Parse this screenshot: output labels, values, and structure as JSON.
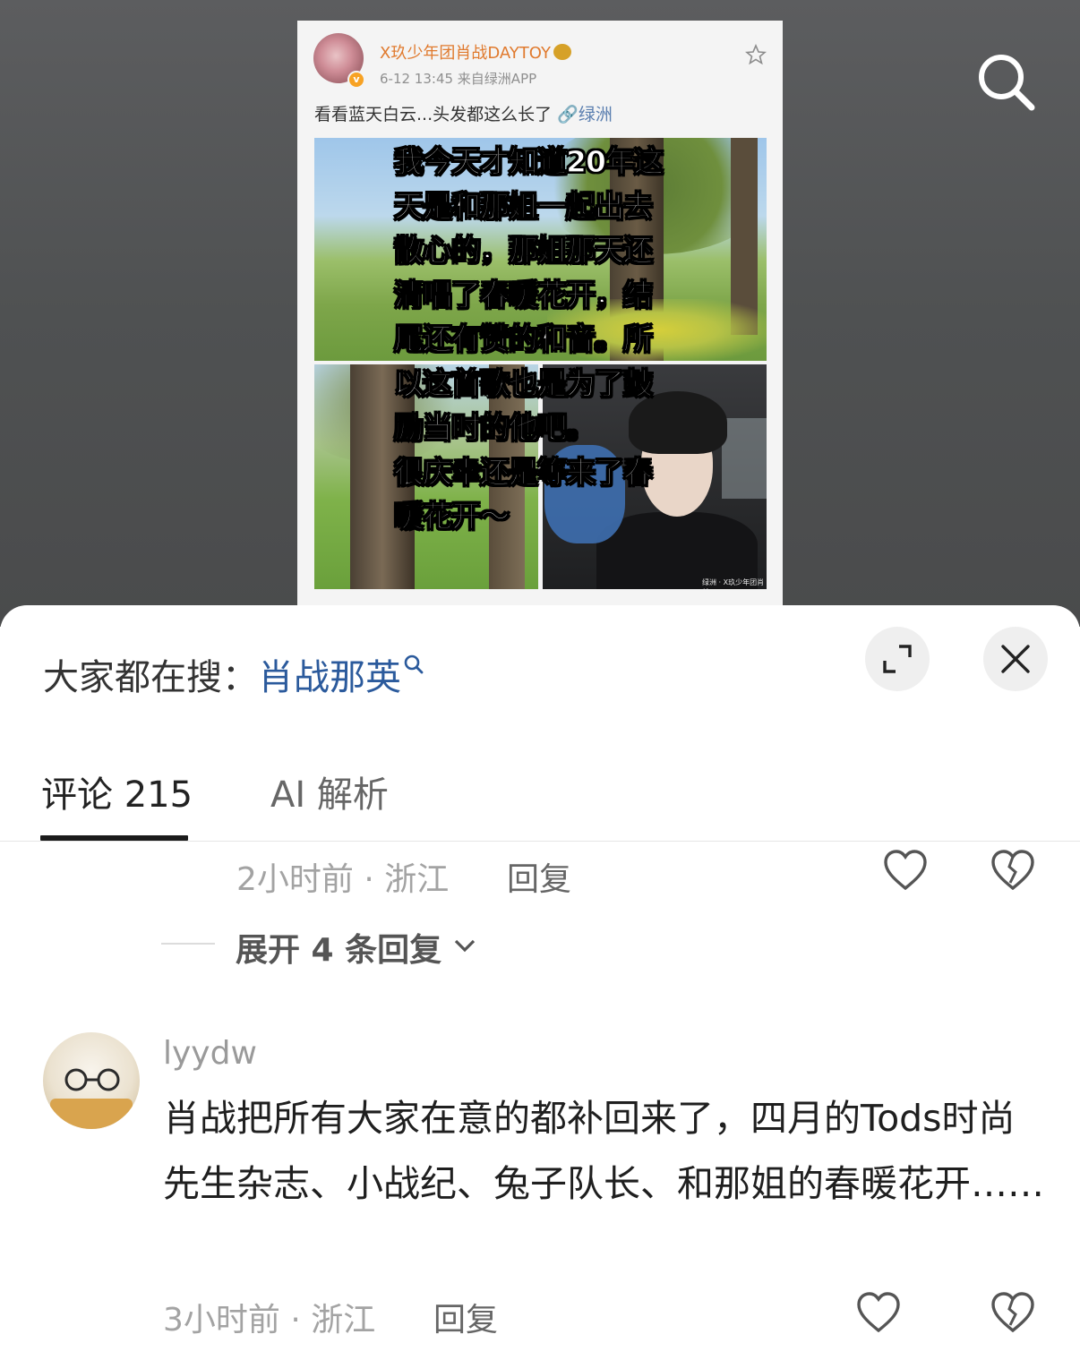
{
  "post": {
    "author": "X玖少年团肖战DAYTOY",
    "meta": "6-12 13:45  来自绿洲APP",
    "text": "看看蓝天白云...头发都这么长了",
    "link": "🔗绿洲",
    "watermark": "绿洲 · X玖少年团肖战DAYTOY",
    "overlay_lines": [
      "我今天才知道20年这",
      "天是和那姐一起出去",
      "散心的，那姐那天还",
      "清唱了春暖花开，结",
      "尾还有赞的和音。所",
      "以这首歌也是为了鼓",
      "励当时的他吧。",
      "很庆幸还是等来了春",
      "暖花开～"
    ]
  },
  "sheet": {
    "trending_label": "大家都在搜：",
    "trending_value": "肖战那英",
    "tabs": [
      {
        "label": "评论 215",
        "active": true
      },
      {
        "label": "AI 解析",
        "active": false
      }
    ]
  },
  "comments": [
    {
      "meta": "2小时前 · 浙江",
      "reply_label": "回复",
      "expand_replies": "展开 4 条回复"
    },
    {
      "author": "lyydw",
      "body": "肖战把所有大家在意的都补回来了，四月的Tods时尚先生杂志、小战纪、兔子队长、和那姐的春暖花开……",
      "meta": "3小时前 · 浙江",
      "reply_label": "回复"
    }
  ],
  "colors": {
    "link_blue": "#2b5a9c",
    "author_orange": "#e07a2e",
    "muted_gray": "#a3a3a3"
  },
  "icons": [
    "search-icon",
    "star-icon",
    "expand-icon",
    "close-icon",
    "heart-icon",
    "broken-heart-icon",
    "chevron-down-icon"
  ]
}
